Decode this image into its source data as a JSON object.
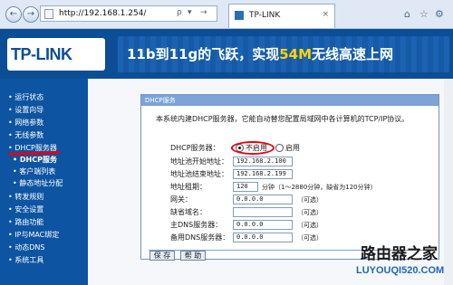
{
  "browser": {
    "url": "http://192.168.1.254/",
    "tab_title": "TP-LINK",
    "tab_close": "×",
    "back": "←",
    "forward": "→",
    "addr_search": "ρ",
    "addr_dropdown": "▾",
    "addr_refresh": "→",
    "home": "⌂",
    "favorites": "☆",
    "settings": "⚙"
  },
  "banner": {
    "logo": "TP-LINK",
    "slogan_part1": "11b到11g的飞跃，实现",
    "slogan_highlight": "54M",
    "slogan_part2": "无线高速上网"
  },
  "sidebar": {
    "items": [
      {
        "label": "• 运行状态",
        "sub": false
      },
      {
        "label": "• 设置向导",
        "sub": false
      },
      {
        "label": "• 网络参数",
        "sub": false
      },
      {
        "label": "• 无线参数",
        "sub": false
      },
      {
        "label": "• DHCP服务器",
        "sub": false
      },
      {
        "label": "• DHCP服务",
        "sub": true,
        "active": true
      },
      {
        "label": "• 客户端列表",
        "sub": true
      },
      {
        "label": "• 静态地址分配",
        "sub": true
      },
      {
        "label": "• 转发规则",
        "sub": false
      },
      {
        "label": "• 安全设置",
        "sub": false
      },
      {
        "label": "• 路由功能",
        "sub": false
      },
      {
        "label": "• IP与MAC绑定",
        "sub": false
      },
      {
        "label": "• 动态DNS",
        "sub": false
      },
      {
        "label": "• 系统工具",
        "sub": false
      }
    ]
  },
  "panel": {
    "title": "DHCP服务",
    "description": "本系统内建DHCP服务器，它能自动替您配置局域网中各计算机的TCP/IP协议。",
    "dhcp_server_label": "DHCP服务器：",
    "option_off": "不启用",
    "option_on": "启用",
    "start_label": "地址池开始地址：",
    "start_value": "192.168.2.100",
    "end_label": "地址池结束地址：",
    "end_value": "192.168.2.199",
    "lease_label": "地址租期：",
    "lease_value": "120",
    "lease_note": "分钟（1～2880分钟，缺省为120分钟）",
    "gateway_label": "网关：",
    "gateway_value": "0.0.0.0",
    "domain_label": "缺省域名：",
    "domain_value": "",
    "dns1_label": "主DNS服务器：",
    "dns1_value": "0.0.0.0",
    "dns2_label": "备用DNS服务器：",
    "dns2_value": "0.0.0.0",
    "optional": "（可选）",
    "save_label": "保 存",
    "help_label": "帮 助"
  },
  "watermark": {
    "line1": "路由器之家",
    "line2": "LUYOUQI520.COM"
  },
  "colors": {
    "banner": "#0b4e96",
    "sidebar": "#0d55a2",
    "panel_header": "#7da3d7",
    "annotation": "#e60012"
  }
}
